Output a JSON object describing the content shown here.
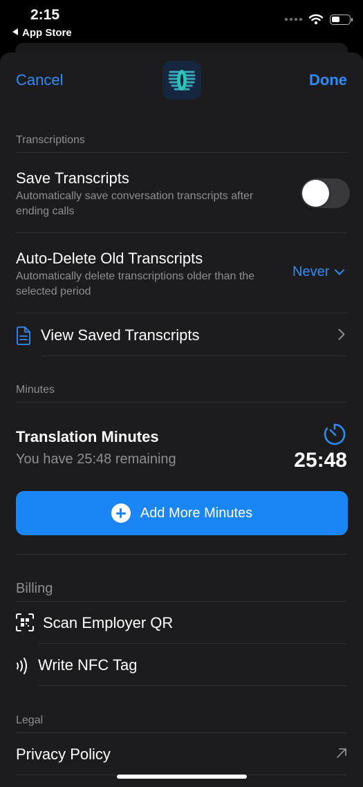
{
  "status_bar": {
    "time": "2:15",
    "back_label": "App Store"
  },
  "nav": {
    "cancel_label": "Cancel",
    "done_label": "Done"
  },
  "transcriptions": {
    "header": "Transcriptions",
    "save": {
      "title": "Save Transcripts",
      "subtitle": "Automatically save conversation transcripts after ending calls",
      "enabled": false
    },
    "auto_delete": {
      "title": "Auto-Delete Old Transcripts",
      "subtitle": "Automatically delete transcriptions older than the selected period",
      "value": "Never"
    },
    "view_saved_label": "View Saved Transcripts"
  },
  "minutes": {
    "header": "Minutes",
    "title": "Translation Minutes",
    "remaining_text": "You have 25:48 remaining",
    "value": "25:48",
    "add_button_label": "Add More Minutes"
  },
  "billing": {
    "header": "Billing",
    "scan_label": "Scan Employer QR",
    "nfc_label": "Write NFC Tag"
  },
  "legal": {
    "header": "Legal",
    "privacy_label": "Privacy Policy"
  },
  "colors": {
    "accent": "#2f8cf5",
    "button": "#1a86f5",
    "sheet": "#1c1c1e"
  }
}
